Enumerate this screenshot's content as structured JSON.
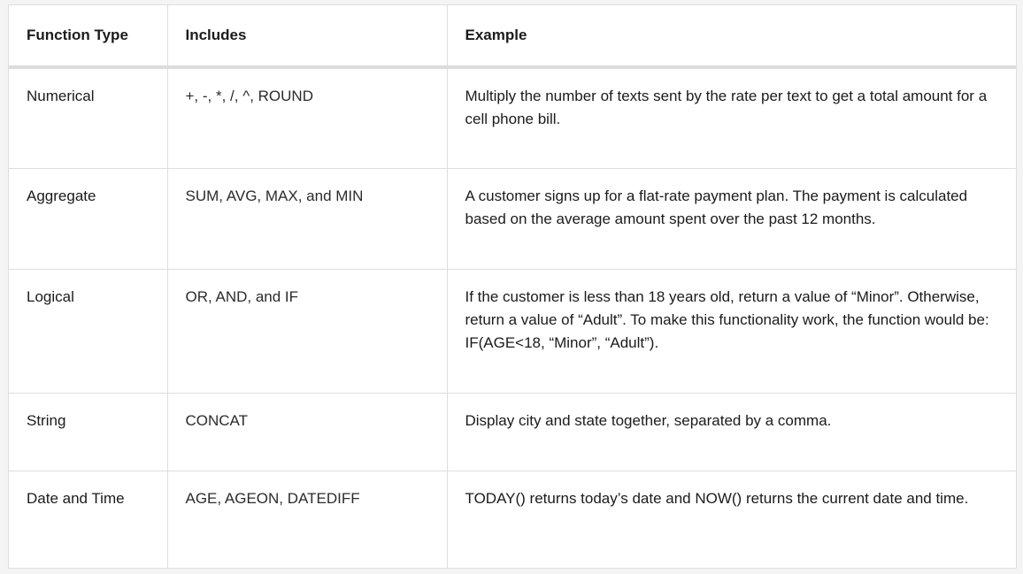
{
  "table": {
    "headers": {
      "function_type": "Function Type",
      "includes": "Includes",
      "example": "Example"
    },
    "rows": [
      {
        "function_type": "Numerical",
        "includes": "+, -, *, /, ^, ROUND",
        "example": "Multiply the number of texts sent by the rate per text to get a total amount for a cell phone bill."
      },
      {
        "function_type": "Aggregate",
        "includes": "SUM, AVG, MAX, and MIN",
        "example": "A customer signs up for a flat-rate payment plan. The payment is calculated based on the average amount spent over the past 12 months."
      },
      {
        "function_type": "Logical",
        "includes": "OR, AND, and IF",
        "example": "If the customer is less than 18 years old, return a value of “Minor”. Otherwise, return a value of “Adult”. To make this functionality work, the function would be: IF(AGE<18, “Minor”, “Adult”)."
      },
      {
        "function_type": "String",
        "includes": "CONCAT",
        "example": "Display city and state together, separated by a comma."
      },
      {
        "function_type": "Date and Time",
        "includes": "AGE, AGEON, DATEDIFF",
        "example": "TODAY() returns today’s date and NOW() returns the current date and time."
      }
    ]
  },
  "colors": {
    "border": "#dedede",
    "header_rule": "#dcdcdc",
    "page_bg": "#f4f4f4",
    "text": "#1b1b1b"
  }
}
